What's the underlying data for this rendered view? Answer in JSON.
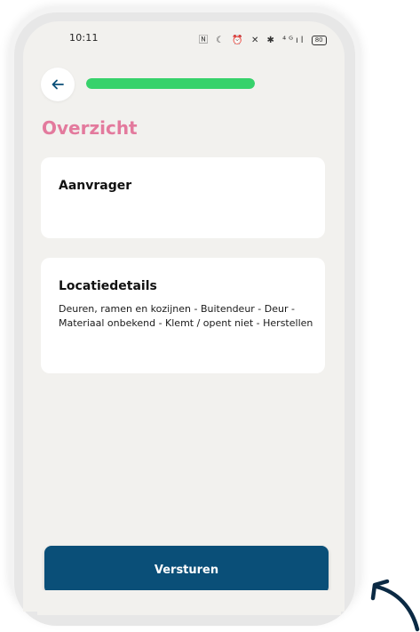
{
  "status_bar": {
    "time": "10:11",
    "icons": [
      "nfc-icon",
      "moon-icon",
      "alarm-icon",
      "mute-icon",
      "bluetooth-icon",
      "signal-icon"
    ],
    "icons_text": "🄽 ☾ ⏰ ✕ ✱ ⁴ᴳıl",
    "battery": "80"
  },
  "header": {
    "back_icon": "arrow-left-icon",
    "progress_fraction": 1.0,
    "progress_color": "#37d26b"
  },
  "page": {
    "title": "Overzicht",
    "title_color": "#e37a9d"
  },
  "cards": {
    "applicant": {
      "title": "Aanvrager"
    },
    "location": {
      "title": "Locatiedetails",
      "body": "Deuren, ramen en kozijnen - Buitendeur - Deur - Materiaal onbekend - Klemt / opent niet - Herstellen"
    }
  },
  "footer": {
    "submit_label": "Versturen",
    "submit_color": "#0a4f78"
  },
  "decor": {
    "pointer": "curved-arrow-icon"
  }
}
